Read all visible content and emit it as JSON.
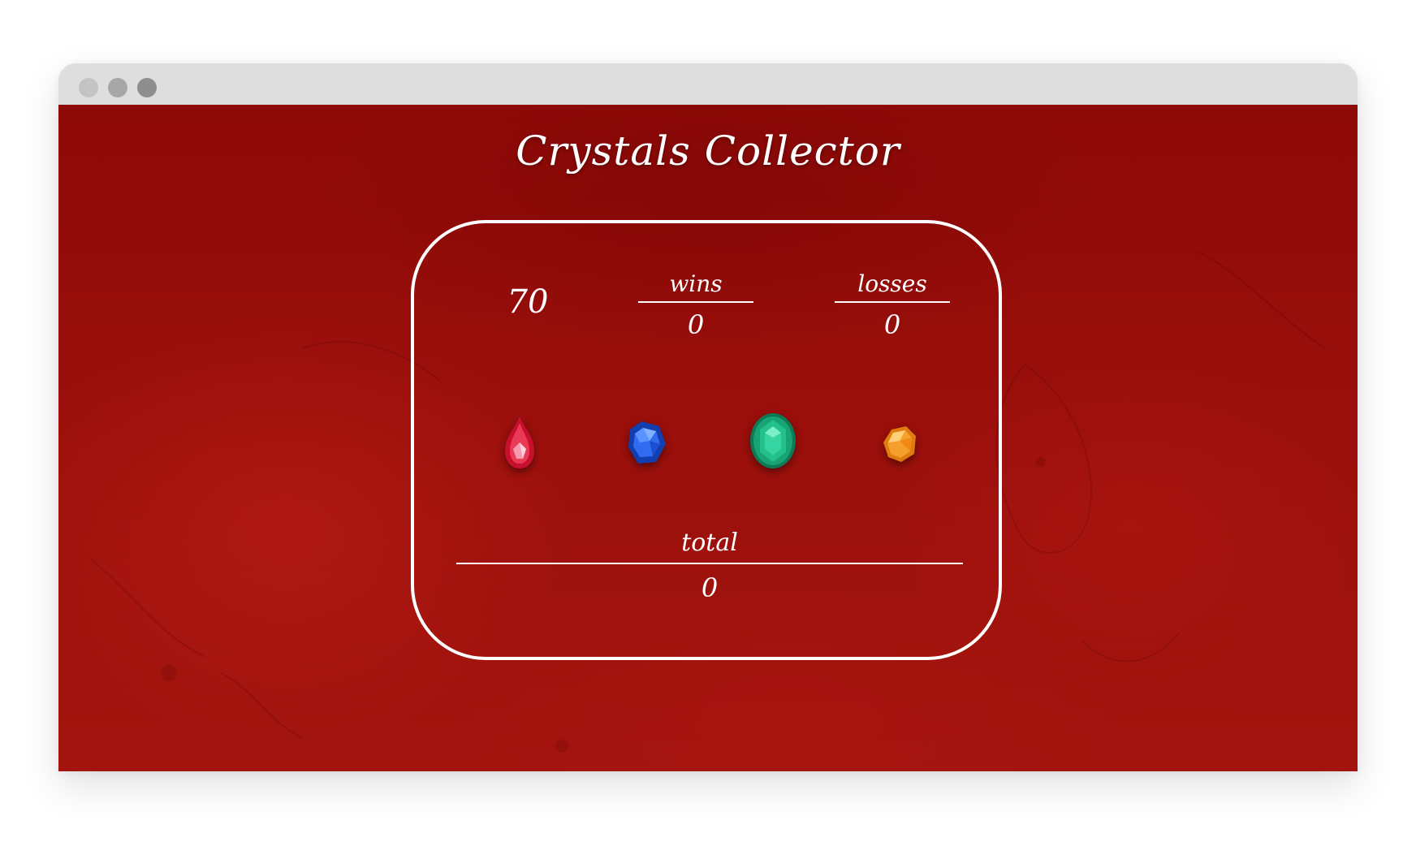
{
  "window": {
    "controls": [
      "close",
      "minimize",
      "maximize"
    ]
  },
  "game": {
    "title": "Crystals Collector",
    "target_number": "70",
    "wins": {
      "label": "wins",
      "value": "0"
    },
    "losses": {
      "label": "losses",
      "value": "0"
    },
    "total": {
      "label": "total",
      "value": "0"
    },
    "crystals": [
      {
        "name": "red-crystal",
        "color": "#d8243e"
      },
      {
        "name": "blue-crystal",
        "color": "#1f5fe0"
      },
      {
        "name": "green-crystal",
        "color": "#1fae7d"
      },
      {
        "name": "orange-crystal",
        "color": "#f59a25"
      }
    ]
  },
  "theme": {
    "background": "#980e0a",
    "foreground": "#ffffff"
  }
}
